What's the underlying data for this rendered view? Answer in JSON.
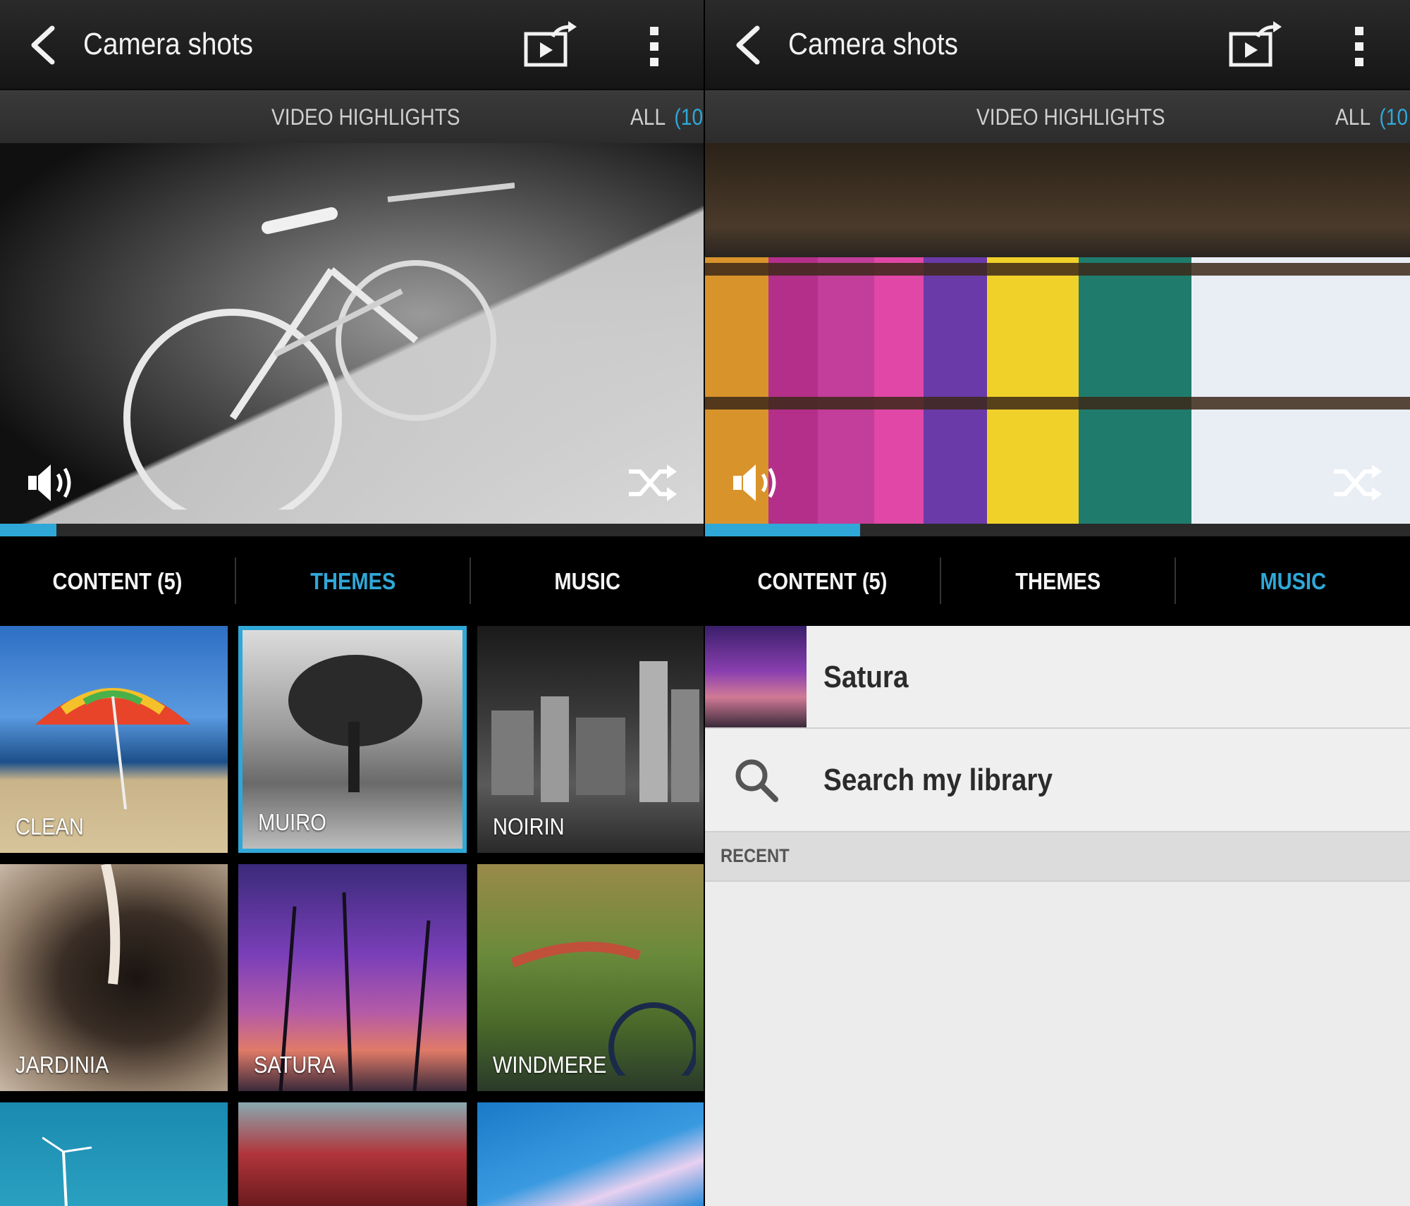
{
  "left": {
    "actionbar": {
      "title": "Camera shots"
    },
    "strip": {
      "video_highlights": "VIDEO HIGHLIGHTS",
      "all": "ALL",
      "all_count": "(10"
    },
    "progress": 0.08,
    "tabs": [
      {
        "label": "CONTENT (5)",
        "active": false
      },
      {
        "label": "THEMES",
        "active": true
      },
      {
        "label": "MUSIC",
        "active": false
      }
    ],
    "themes": [
      {
        "label": "CLEAN",
        "selected": false
      },
      {
        "label": "MUIRO",
        "selected": true
      },
      {
        "label": "NOIRIN",
        "selected": false
      },
      {
        "label": "JARDINIA",
        "selected": false
      },
      {
        "label": "SATURA",
        "selected": false
      },
      {
        "label": "WINDMERE",
        "selected": false
      },
      {
        "label": "",
        "selected": false
      },
      {
        "label": "",
        "selected": false
      },
      {
        "label": "",
        "selected": false
      }
    ]
  },
  "right": {
    "actionbar": {
      "title": "Camera shots"
    },
    "strip": {
      "video_highlights": "VIDEO HIGHLIGHTS",
      "all": "ALL",
      "all_count": "(10"
    },
    "progress": 0.22,
    "tabs": [
      {
        "label": "CONTENT (5)",
        "active": false
      },
      {
        "label": "THEMES",
        "active": false
      },
      {
        "label": "MUSIC",
        "active": true
      }
    ],
    "music": {
      "current_track": "Satura",
      "search_label": "Search my library",
      "recent_header": "RECENT"
    }
  },
  "colors": {
    "accent": "#2fa8d8",
    "bar": "#1e1e1e",
    "list_bg": "#ececec"
  },
  "icons": [
    "back-arrow",
    "share-video",
    "overflow-menu",
    "volume",
    "shuffle",
    "search"
  ]
}
